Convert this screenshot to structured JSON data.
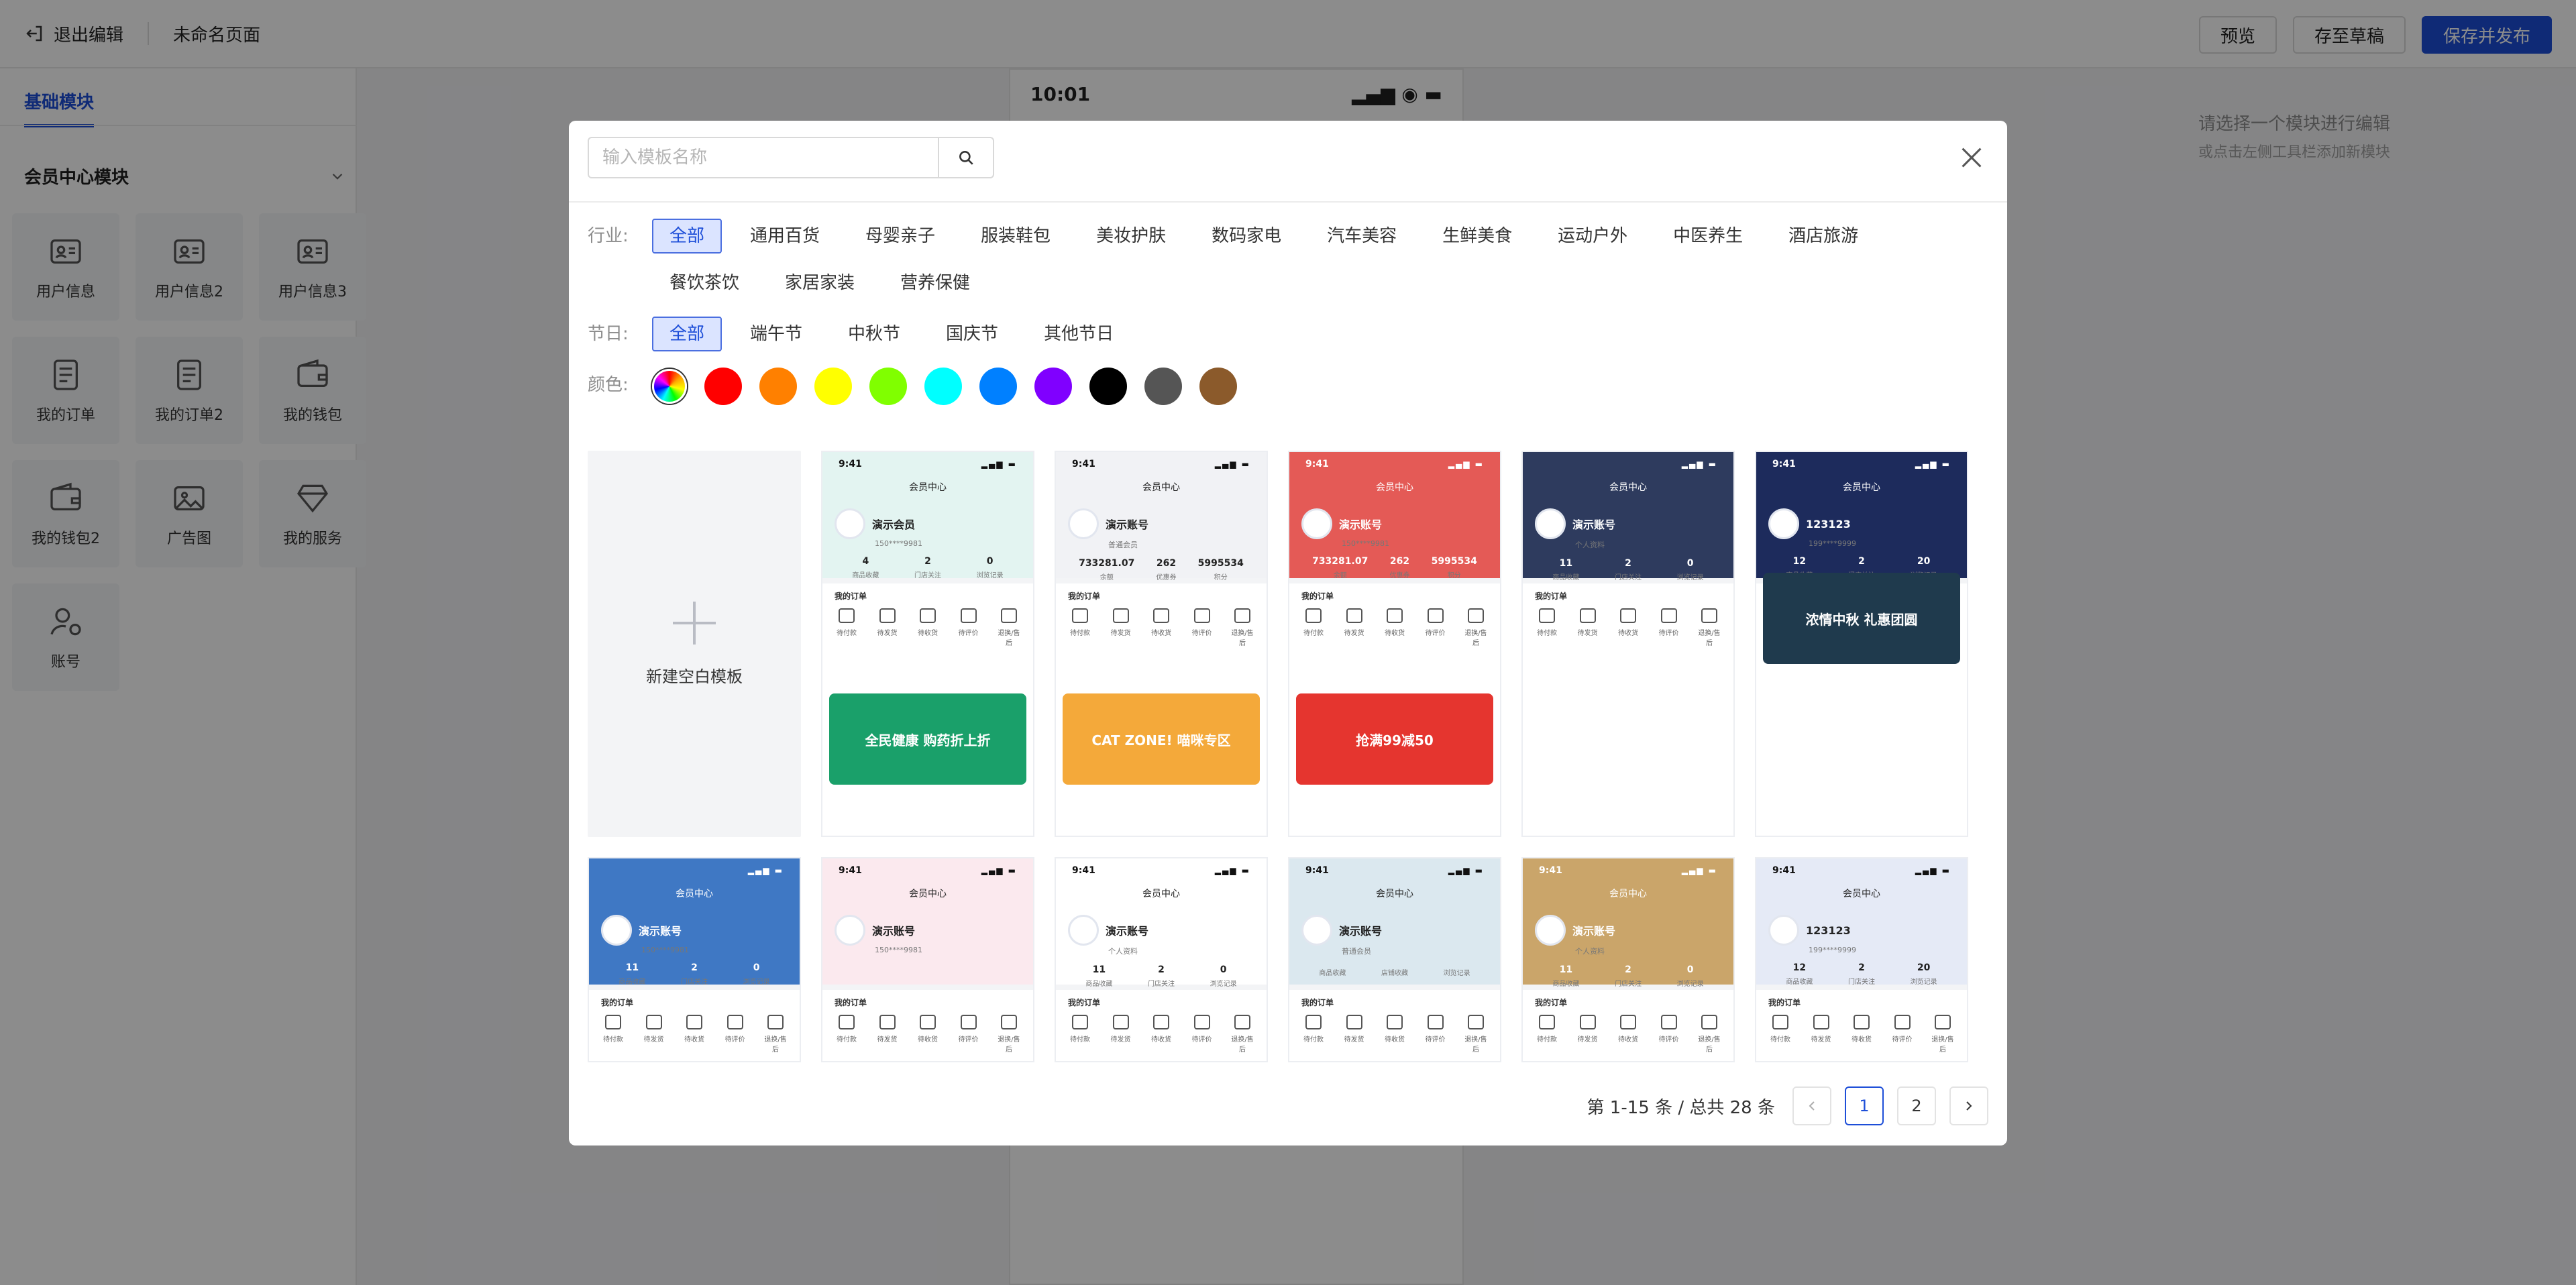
{
  "topbar": {
    "exit_label": "退出编辑",
    "page_name": "未命名页面",
    "preview_label": "预览",
    "draft_label": "存至草稿",
    "publish_label": "保存并发布"
  },
  "sidebar": {
    "tab": "基础模块",
    "group": "会员中心模块",
    "items": [
      {
        "label": "用户信息",
        "icon": "id-card-icon"
      },
      {
        "label": "用户信息2",
        "icon": "id-card-icon"
      },
      {
        "label": "用户信息3",
        "icon": "id-card-icon"
      },
      {
        "label": "我的订单",
        "icon": "order-icon"
      },
      {
        "label": "我的订单2",
        "icon": "order-icon"
      },
      {
        "label": "我的钱包",
        "icon": "wallet-icon"
      },
      {
        "label": "我的钱包2",
        "icon": "wallet-icon"
      },
      {
        "label": "广告图",
        "icon": "image-icon"
      },
      {
        "label": "我的服务",
        "icon": "diamond-icon"
      },
      {
        "label": "账号",
        "icon": "account-icon"
      }
    ]
  },
  "phone": {
    "time": "10:01"
  },
  "hint": {
    "line1": "请选择一个模块进行编辑",
    "line2": "或点击左侧工具栏添加新模块"
  },
  "modal": {
    "search_placeholder": "输入模板名称",
    "industry_label": "行业:",
    "industries": [
      "全部",
      "通用百货",
      "母婴亲子",
      "服装鞋包",
      "美妆护肤",
      "数码家电",
      "汽车美容",
      "生鲜美食",
      "运动户外",
      "中医养生",
      "酒店旅游",
      "餐饮茶饮",
      "家居家装",
      "营养保健"
    ],
    "festival_label": "节日:",
    "festivals": [
      "全部",
      "端午节",
      "中秋节",
      "国庆节",
      "其他节日"
    ],
    "color_label": "颜色:",
    "colors": [
      "#ff0000",
      "#ff8000",
      "#ffff00",
      "#80ff00",
      "#00ffff",
      "#0080ff",
      "#8000ff",
      "#000000",
      "#555555",
      "#8b5a2b"
    ],
    "new_template_label": "新建空白模板",
    "templates": [
      {
        "time": "9:41",
        "title": "会员中心",
        "head": "#e3f4f1",
        "name": "演示会员",
        "sub": "150****9981",
        "stats": [
          "4",
          "2",
          "0"
        ],
        "labels": [
          "商品收藏",
          "门店关注",
          "浏览记录"
        ],
        "banner": "全民健康 购药折上折",
        "banner_color": "#1aa06a"
      },
      {
        "time": "9:41",
        "title": "会员中心",
        "head": "#f1f2f5",
        "name": "演示账号",
        "sub": "普通会员",
        "stats": [
          "733281.07",
          "262",
          "5995534"
        ],
        "labels": [
          "余额",
          "优惠券",
          "积分"
        ],
        "banner": "CAT ZONE! 喵咪专区",
        "banner_color": "#f4a93a"
      },
      {
        "time": "9:41",
        "title": "会员中心",
        "head": "#e45a56",
        "name": "演示账号",
        "sub": "150****9981",
        "stats": [
          "733281.07",
          "262",
          "5995534"
        ],
        "labels": [
          "余额",
          "优惠券",
          "积分"
        ],
        "banner": "抢满99减50",
        "banner_color": "#e5352f"
      },
      {
        "time": "",
        "title": "会员中心",
        "head": "#2e3b5e",
        "name": "演示账号",
        "sub": "个人资料",
        "stats": [
          "11",
          "2",
          "0"
        ],
        "labels": [
          "商品收藏",
          "门店关注",
          "浏览记录"
        ],
        "banner": "",
        "banner_color": "#ffffff"
      },
      {
        "time": "9:41",
        "title": "会员中心",
        "head": "#1d2b5c",
        "name": "123123",
        "sub": "199****9999",
        "stats": [
          "12",
          "2",
          "20"
        ],
        "labels": [
          "商品收藏",
          "门店关注",
          "浏览记录"
        ],
        "banner": "浓情中秋 礼惠团圆",
        "banner_color": "#1f3a4d"
      },
      {
        "time": "",
        "title": "会员中心",
        "head": "#3f78c4",
        "name": "演示账号",
        "sub": "150****9981",
        "stats": [
          "11",
          "2",
          "0"
        ],
        "labels": [
          "商品收藏",
          "门店关注",
          "浏览记录"
        ],
        "banner": "",
        "banner_color": "#ffffff"
      },
      {
        "time": "9:41",
        "title": "会员中心",
        "head": "#fbe9ee",
        "name": "演示账号",
        "sub": "150****9981",
        "stats": [
          "",
          "",
          ""
        ],
        "labels": [
          "",
          "",
          ""
        ],
        "banner": "",
        "banner_color": "#ffffff"
      },
      {
        "time": "9:41",
        "title": "会员中心",
        "head": "#ffffff",
        "name": "演示账号",
        "sub": "个人资料",
        "stats": [
          "11",
          "2",
          "0"
        ],
        "labels": [
          "商品收藏",
          "门店关注",
          "浏览记录"
        ],
        "banner": "",
        "banner_color": "#ffffff"
      },
      {
        "time": "9:41",
        "title": "会员中心",
        "head": "#dbe8ef",
        "name": "演示账号",
        "sub": "普通会员",
        "stats": [
          "",
          "",
          ""
        ],
        "labels": [
          "商品收藏",
          "店铺收藏",
          "浏览记录"
        ],
        "banner": "",
        "banner_color": "#ffffff"
      },
      {
        "time": "9:41",
        "title": "会员中心",
        "head": "#caa56a",
        "name": "演示账号",
        "sub": "个人资料",
        "stats": [
          "11",
          "2",
          "0"
        ],
        "labels": [
          "商品收藏",
          "门店关注",
          "浏览记录"
        ],
        "banner": "",
        "banner_color": "#ffffff"
      },
      {
        "time": "9:41",
        "title": "会员中心",
        "head": "#e5eaf6",
        "name": "123123",
        "sub": "199****9999",
        "stats": [
          "12",
          "2",
          "20"
        ],
        "labels": [
          "商品收藏",
          "门店关注",
          "浏览记录"
        ],
        "banner": "",
        "banner_color": "#ffffff"
      }
    ],
    "order_heading": "我的订单",
    "order_items": [
      "待付款",
      "待发货",
      "待收货",
      "待评价",
      "退换/售后"
    ],
    "pager": {
      "total": "第 1-15 条 / 总共 28 条",
      "pages": [
        "1",
        "2"
      ]
    }
  }
}
